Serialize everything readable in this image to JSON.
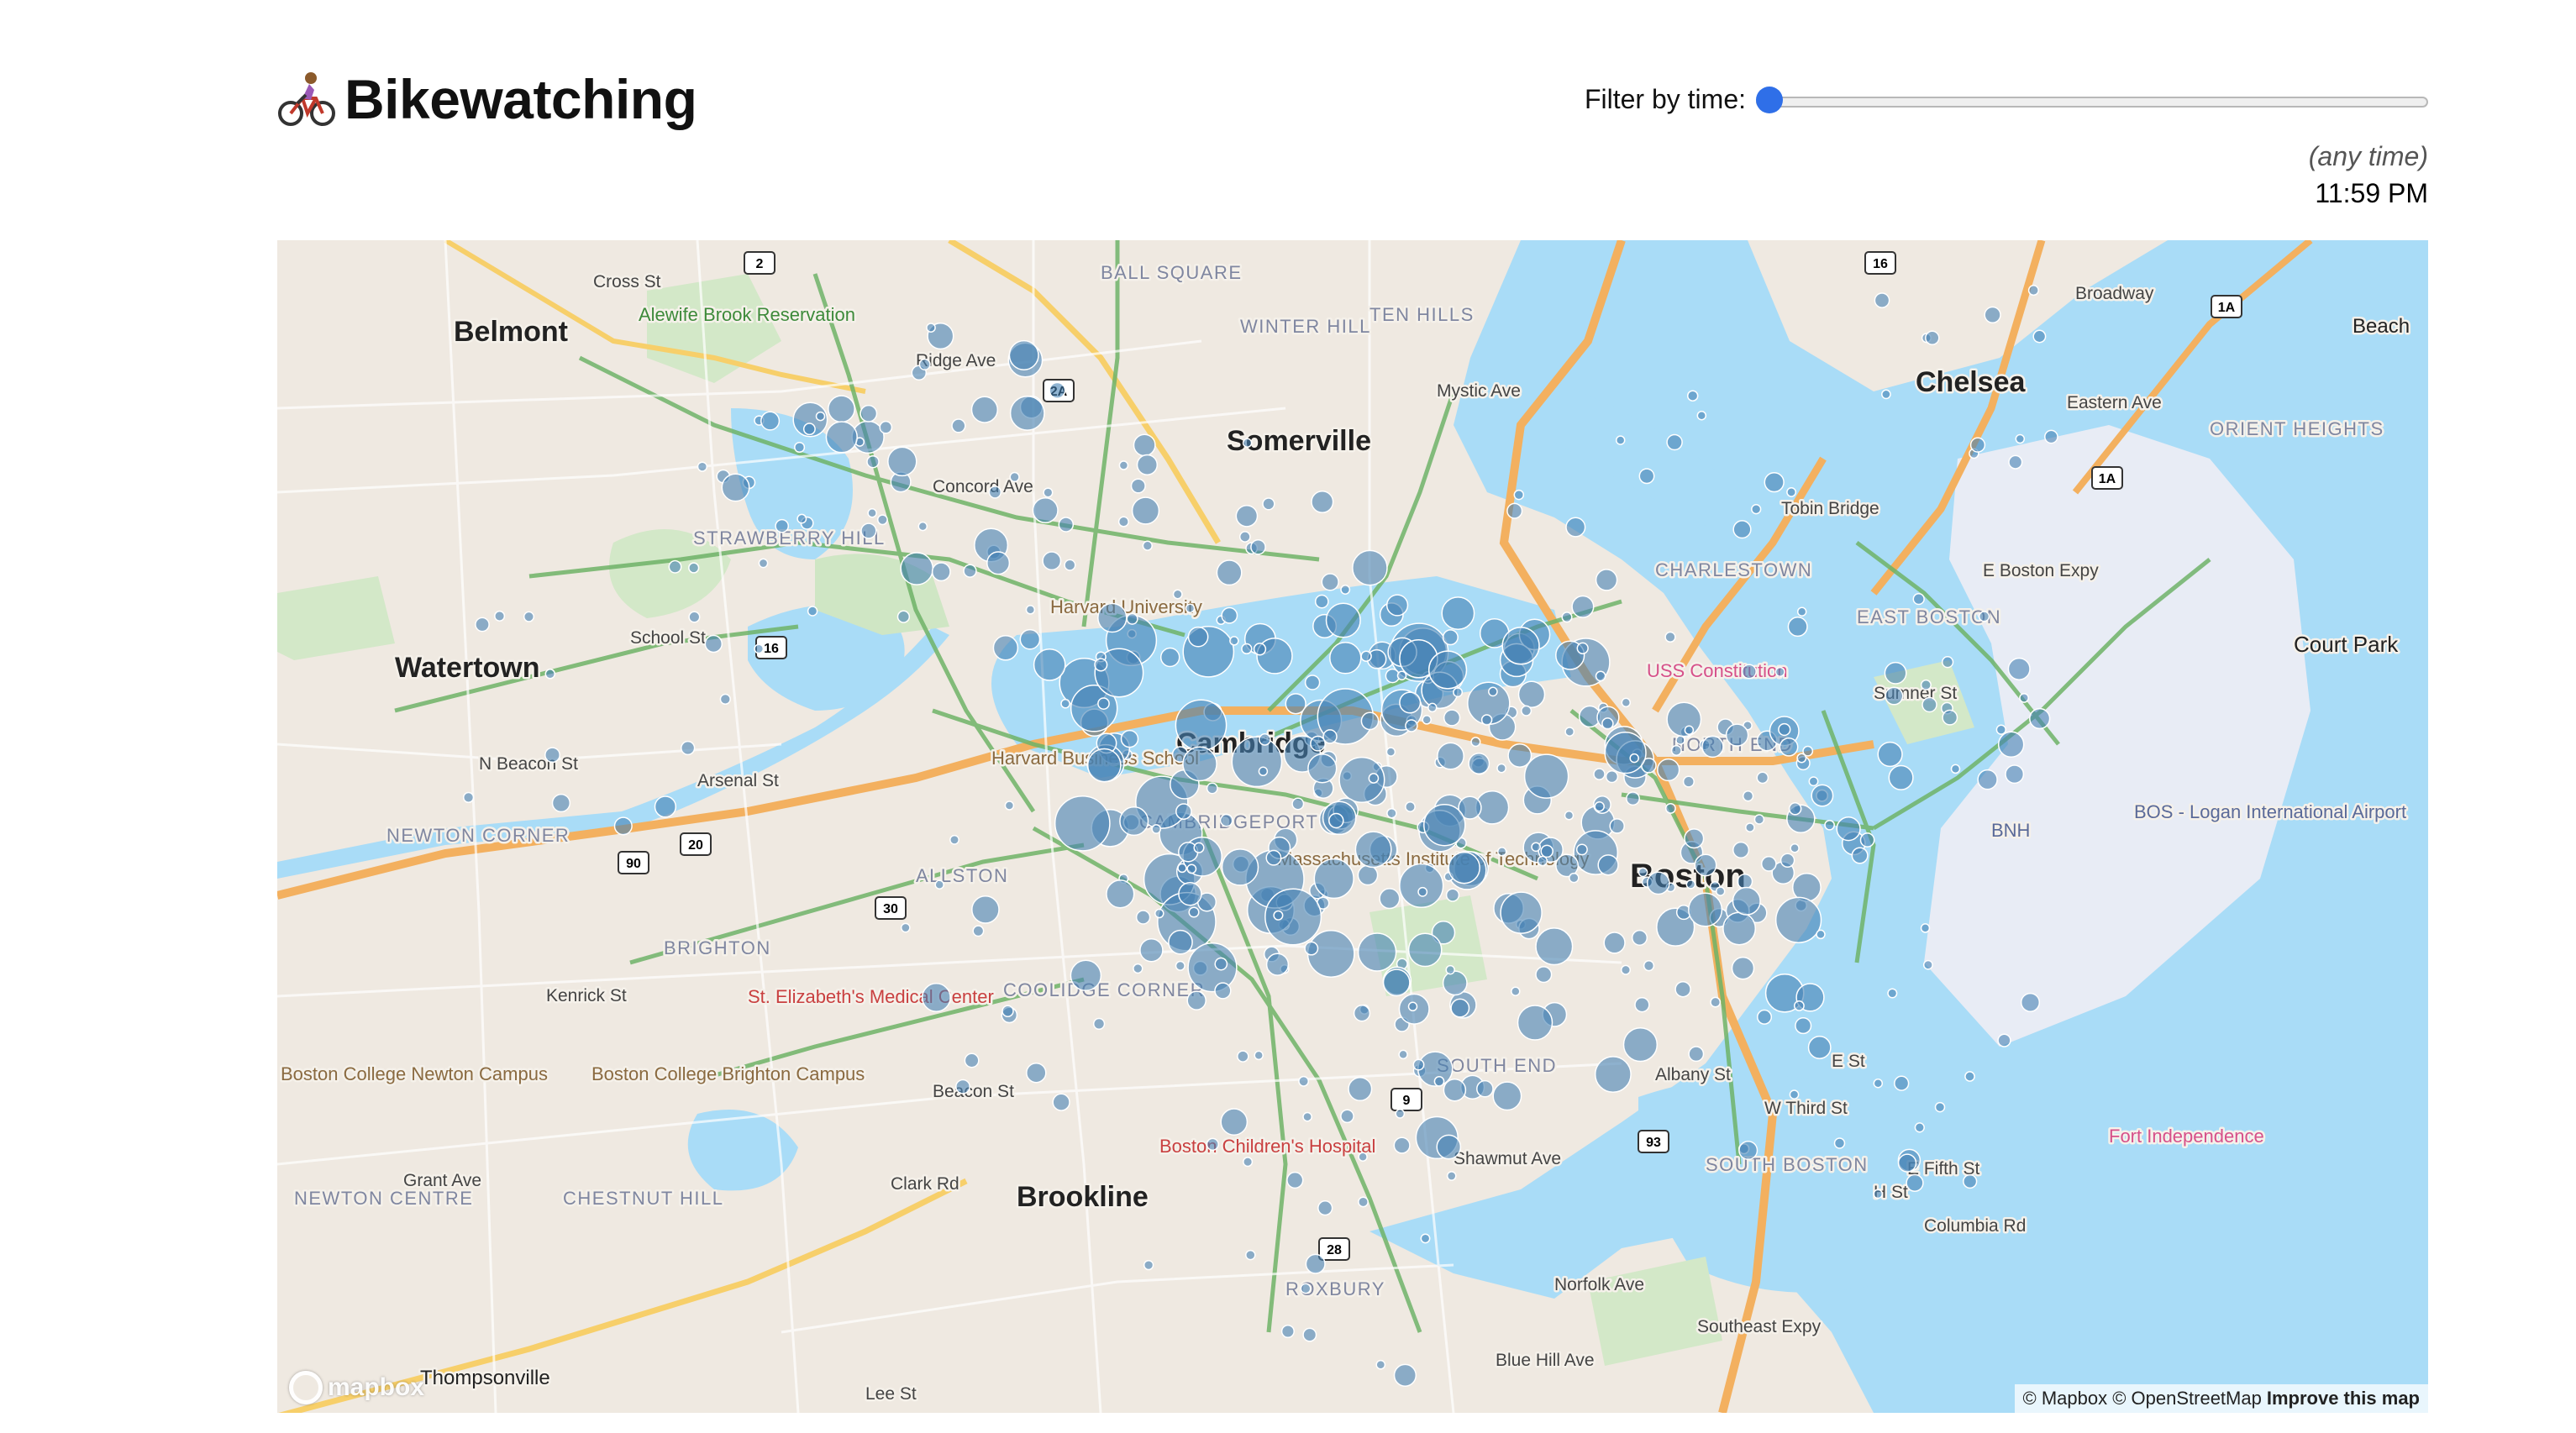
{
  "header": {
    "title": "Bikewatching",
    "filter_label": "Filter by time:",
    "time_any": "(any time)",
    "time_value": "11:59 PM",
    "slider_fraction": 0
  },
  "map": {
    "labels": {
      "belmont": "Belmont",
      "watertown": "Watertown",
      "somerville": "Somerville",
      "cambridge": "Cambridge",
      "chelsea": "Chelsea",
      "boston": "Boston",
      "brookline": "Brookline",
      "court_park": "Court Park",
      "beach": "Beach",
      "strawberry_hill": "STRAWBERRY HILL",
      "newton_corner": "NEWTON CORNER",
      "allston": "ALLSTON",
      "brighton": "BRIGHTON",
      "charlestown": "CHARLESTOWN",
      "east_boston": "EAST BOSTON",
      "north_end": "NORTH END",
      "south_boston": "SOUTH BOSTON",
      "roxbury": "ROXBURY",
      "chestnut_hill": "CHESTNUT HILL",
      "newton_centre": "NEWTON CENTRE",
      "ball_square": "BALL SQUARE",
      "winter_hill": "WINTER HILL",
      "ten_hills": "TEN HILLS",
      "orient_heights": "ORIENT HEIGHTS",
      "cambridgeport": "CAMBRIDGEPORT",
      "coolidge_corner": "COOLIDGE CORNER",
      "south_end": "SOUTH END",
      "thompsonville": "Thompsonville",
      "alewife": "Alewife Brook Reservation",
      "hbs": "Harvard Business School",
      "mit": "Massachusetts Institute of Technology",
      "st_elizabeth": "St. Elizabeth's Medical Center",
      "bc_newton": "Boston College Newton Campus",
      "bc_brighton": "Boston College Brighton Campus",
      "childrens": "Boston Children's Hospital",
      "uss": "USS Constitution",
      "fort": "Fort Independence",
      "airport": "BOS - Logan International Airport",
      "bnh": "BNH",
      "harvard": "Harvard University",
      "n_beacon": "N Beacon St",
      "arsenal": "Arsenal St",
      "kenrick": "Kenrick St",
      "beacon": "Beacon St",
      "concord": "Concord Ave",
      "ridge": "Ridge Ave",
      "cross": "Cross St",
      "mystic": "Mystic Ave",
      "tobin": "Tobin Bridge",
      "broadway": "Broadway",
      "eastern": "Eastern Ave",
      "shawmut": "Shawmut Ave",
      "albany": "Albany St",
      "e_fifth": "E Fifth St",
      "columbia": "Columbia Rd",
      "sumner": "Sumner St",
      "clark": "Clark Rd",
      "lee": "Lee St",
      "grant": "Grant Ave",
      "school": "School St",
      "norfolk": "Norfolk Ave",
      "southeast": "Southeast Expy",
      "e_boston_expy": "E Boston Expy",
      "e_st": "E St",
      "h_st": "H St",
      "third": "W Third St",
      "blue_hill": "Blue Hill Ave"
    },
    "shields": [
      "2",
      "2A",
      "16",
      "20",
      "30",
      "9",
      "28",
      "90",
      "93",
      "1A",
      "16",
      "1A"
    ],
    "attribution_text": "© Mapbox © OpenStreetMap",
    "attribution_link": "Improve this map",
    "logo_text": "mapbox"
  }
}
